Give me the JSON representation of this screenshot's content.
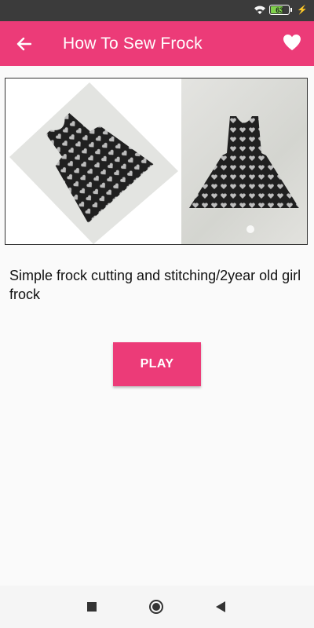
{
  "status_bar": {
    "battery_level": "63",
    "wifi_icon": "wifi-icon",
    "charging_icon": "bolt-icon"
  },
  "app_bar": {
    "title": "How To Sew Frock",
    "back_icon": "arrow-left-icon",
    "favorite_icon": "heart-icon",
    "color": "#ec3b78"
  },
  "video": {
    "thumbnail": "frock-dress-thumbnail",
    "title": "Simple frock cutting and stitching/2year old girl frock"
  },
  "actions": {
    "play_label": "PLAY"
  },
  "nav": {
    "recent_icon": "square-icon",
    "home_icon": "circle-icon",
    "back_icon": "triangle-back-icon"
  }
}
